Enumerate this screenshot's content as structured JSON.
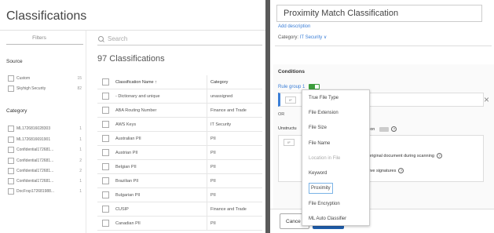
{
  "page": {
    "title": "Classifications"
  },
  "filters": {
    "label": "Filters",
    "source": {
      "title": "Source",
      "items": [
        {
          "label": "Custom",
          "count": "15"
        },
        {
          "label": "Skyhigh Security",
          "count": "82"
        }
      ]
    },
    "category": {
      "title": "Category",
      "items": [
        {
          "label": "ML1726816028303",
          "count": "1"
        },
        {
          "label": "ML1726816691901",
          "count": "1"
        },
        {
          "label": "Confidential172681...",
          "count": "1"
        },
        {
          "label": "Confidential172681...",
          "count": "2"
        },
        {
          "label": "Confidential172681...",
          "count": "2"
        },
        {
          "label": "Confidential172681...",
          "count": "1"
        },
        {
          "label": "DocFrsp172681988...",
          "count": "1"
        }
      ]
    }
  },
  "search": {
    "placeholder": "Search"
  },
  "results": {
    "count_text": "97 Classifications"
  },
  "table": {
    "headers": {
      "name": "Classification Name ↑",
      "category": "Category"
    },
    "rows": [
      {
        "name": "- Dictionary and unique",
        "category": "unassigned"
      },
      {
        "name": "ABA Routing Number",
        "category": "Finance and Trade"
      },
      {
        "name": "AWS Keys",
        "category": "IT Security"
      },
      {
        "name": "Australian PII",
        "category": "PII"
      },
      {
        "name": "Austrian PII",
        "category": "PII"
      },
      {
        "name": "Belgian PII",
        "category": "PII"
      },
      {
        "name": "Brazilian PII",
        "category": "PII"
      },
      {
        "name": "Bulgarian PII",
        "category": "PII"
      },
      {
        "name": "CUSIP",
        "category": "Finance and Trade"
      },
      {
        "name": "Canadian PII",
        "category": "PII"
      }
    ]
  },
  "panel": {
    "title": "Proximity Match Classification",
    "add_description": "Add description",
    "category_label": "Category:",
    "category_value": "IT Security ∨",
    "conditions_title": "Conditions",
    "rule_group": "Rule group 1",
    "if_tag": "IF",
    "or_label": "OR",
    "unstructured_label": "Unstructu",
    "unstructured_tail": "ion",
    "option1": "the original document during scanning",
    "option2": "ecutive signatures",
    "cancel_label": "Cance",
    "close_glyph": "×",
    "help_glyph": "?"
  },
  "dropdown": {
    "items": [
      {
        "label": "True File Type",
        "state": "normal"
      },
      {
        "label": "File Extension",
        "state": "normal"
      },
      {
        "label": "File Size",
        "state": "normal"
      },
      {
        "label": "File Name",
        "state": "normal"
      },
      {
        "label": "Location in File",
        "state": "disabled"
      },
      {
        "label": "Keyword",
        "state": "normal"
      },
      {
        "label": "Proximity",
        "state": "selected"
      },
      {
        "label": "File Encryption",
        "state": "normal"
      },
      {
        "label": "ML Auto Classifier",
        "state": "normal"
      }
    ]
  },
  "colors": {
    "accent": "#3b7ed6",
    "toggle_on": "#3c9d3c",
    "primary_button": "#1f5fae"
  },
  "icons": {
    "search": "search-icon",
    "close": "close-icon",
    "help": "help-icon",
    "sort": "arrow-up-icon"
  }
}
